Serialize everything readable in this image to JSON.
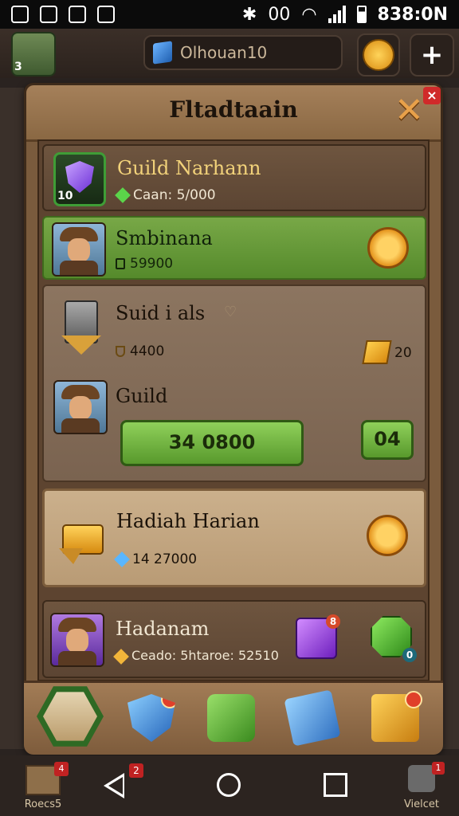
{
  "status_bar": {
    "time": "838:0N",
    "network": "00"
  },
  "top_bar": {
    "avatar_level": "3",
    "player_name": "Olhouan10"
  },
  "panel": {
    "title": "Fltadtaain"
  },
  "guild_header": {
    "level": "10",
    "name": "Guild Narhann",
    "sub": "Caan: 5/000"
  },
  "member1": {
    "name": "Smbinana",
    "value": "59900"
  },
  "section": {
    "title": "Suid i als",
    "cost": "4400",
    "gold_count": "20",
    "guild_label": "Guild",
    "main_button": "34  0800",
    "small_button": "04"
  },
  "treasure": {
    "title": "Hadiah Harian",
    "value": "14 27000"
  },
  "member2": {
    "name": "Hadanam",
    "sub": "Ceado: 5htaroe: 52510",
    "badge_purple": "8",
    "badge_green": "0"
  },
  "nav": {
    "recents_label": "Roecs5",
    "recents_badge": "4",
    "back_badge": "2",
    "right_label": "Vielcet",
    "right_badge": "1"
  },
  "colors": {
    "accent_green": "#6aa83a",
    "gold": "#f2b53a",
    "panel_wood": "#7a5b3d"
  }
}
